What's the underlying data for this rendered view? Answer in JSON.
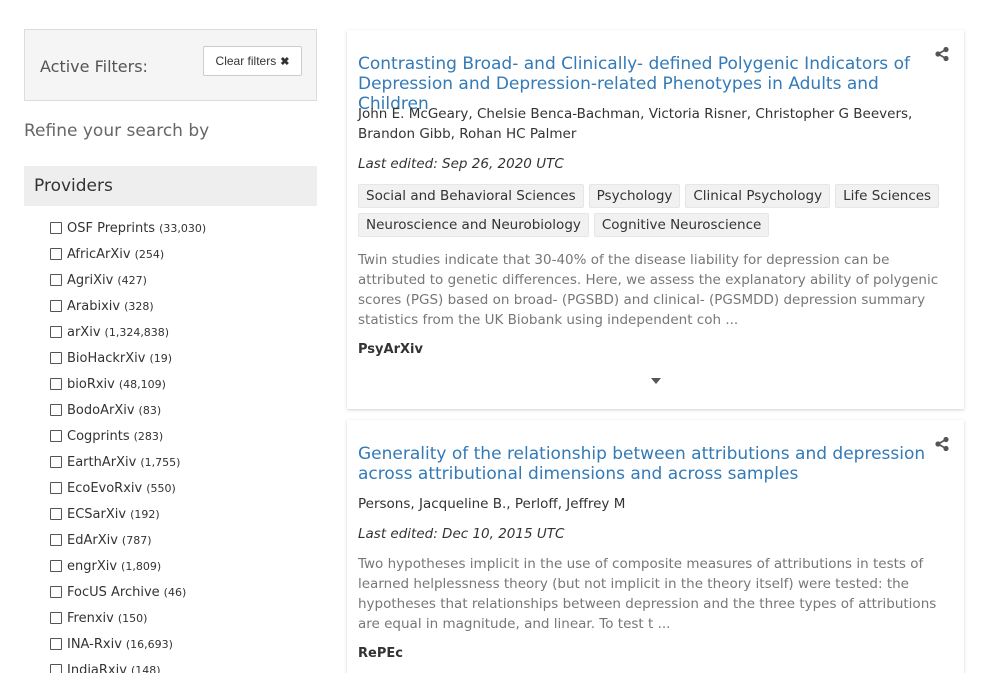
{
  "filters": {
    "active_label": "Active Filters:",
    "clear_label": "Clear filters",
    "clear_icon": "close-icon"
  },
  "refine_label": "Refine your search by",
  "providers": {
    "heading": "Providers",
    "items": [
      {
        "name": "OSF Preprints",
        "count": "(33,030)"
      },
      {
        "name": "AfricArXiv",
        "count": "(254)"
      },
      {
        "name": "AgriXiv",
        "count": "(427)"
      },
      {
        "name": "Arabixiv",
        "count": "(328)"
      },
      {
        "name": "arXiv",
        "count": "(1,324,838)"
      },
      {
        "name": "BioHackrXiv",
        "count": "(19)"
      },
      {
        "name": "bioRxiv",
        "count": "(48,109)"
      },
      {
        "name": "BodoArXiv",
        "count": "(83)"
      },
      {
        "name": "Cogprints",
        "count": "(283)"
      },
      {
        "name": "EarthArXiv",
        "count": "(1,755)"
      },
      {
        "name": "EcoEvoRxiv",
        "count": "(550)"
      },
      {
        "name": "ECSarXiv",
        "count": "(192)"
      },
      {
        "name": "EdArXiv",
        "count": "(787)"
      },
      {
        "name": "engrXiv",
        "count": "(1,809)"
      },
      {
        "name": "FocUS Archive",
        "count": "(46)"
      },
      {
        "name": "Frenxiv",
        "count": "(150)"
      },
      {
        "name": "INA-Rxiv",
        "count": "(16,693)"
      },
      {
        "name": "IndiaRxiv",
        "count": "(148)"
      }
    ]
  },
  "results": [
    {
      "title": "Contrasting Broad- and Clinically- defined Polygenic Indicators of Depression and Depression-related Phenotypes in Adults and Children",
      "authors": "John E. McGeary, Chelsie Benca-Bachman, Victoria Risner, Christopher G Beevers, Brandon Gibb, Rohan HC Palmer",
      "edited": "Last edited: Sep 26, 2020 UTC",
      "tags": [
        "Social and Behavioral Sciences",
        "Psychology",
        "Clinical Psychology",
        "Life Sciences",
        "Neuroscience and Neurobiology",
        "Cognitive Neuroscience"
      ],
      "abstract": "Twin studies indicate that 30-40% of the disease liability for depression can be attributed to genetic differences. Here, we assess the explanatory ability of polygenic scores (PGS) based on broad- (PGSBD) and clinical- (PGSMDD) depression summary statistics from the UK Biobank using independent coh ...",
      "provider": "PsyArXiv",
      "share_icon": "share-icon",
      "expand_icon": "caret-down-icon"
    },
    {
      "title": "Generality of the relationship between attributions and depression across attributional dimensions and across samples",
      "authors": "Persons, Jacqueline B., Perloff, Jeffrey M",
      "edited": "Last edited: Dec 10, 2015 UTC",
      "tags": [],
      "abstract": "Two hypotheses implicit in the use of composite measures of attributions in tests of learned helplessness theory (but not implicit in the theory itself) were tested: the hypotheses that relationships between depression and the three types of attributions are equal in magnitude, and linear. To test t ...",
      "provider": "RePEc",
      "share_icon": "share-icon"
    }
  ]
}
